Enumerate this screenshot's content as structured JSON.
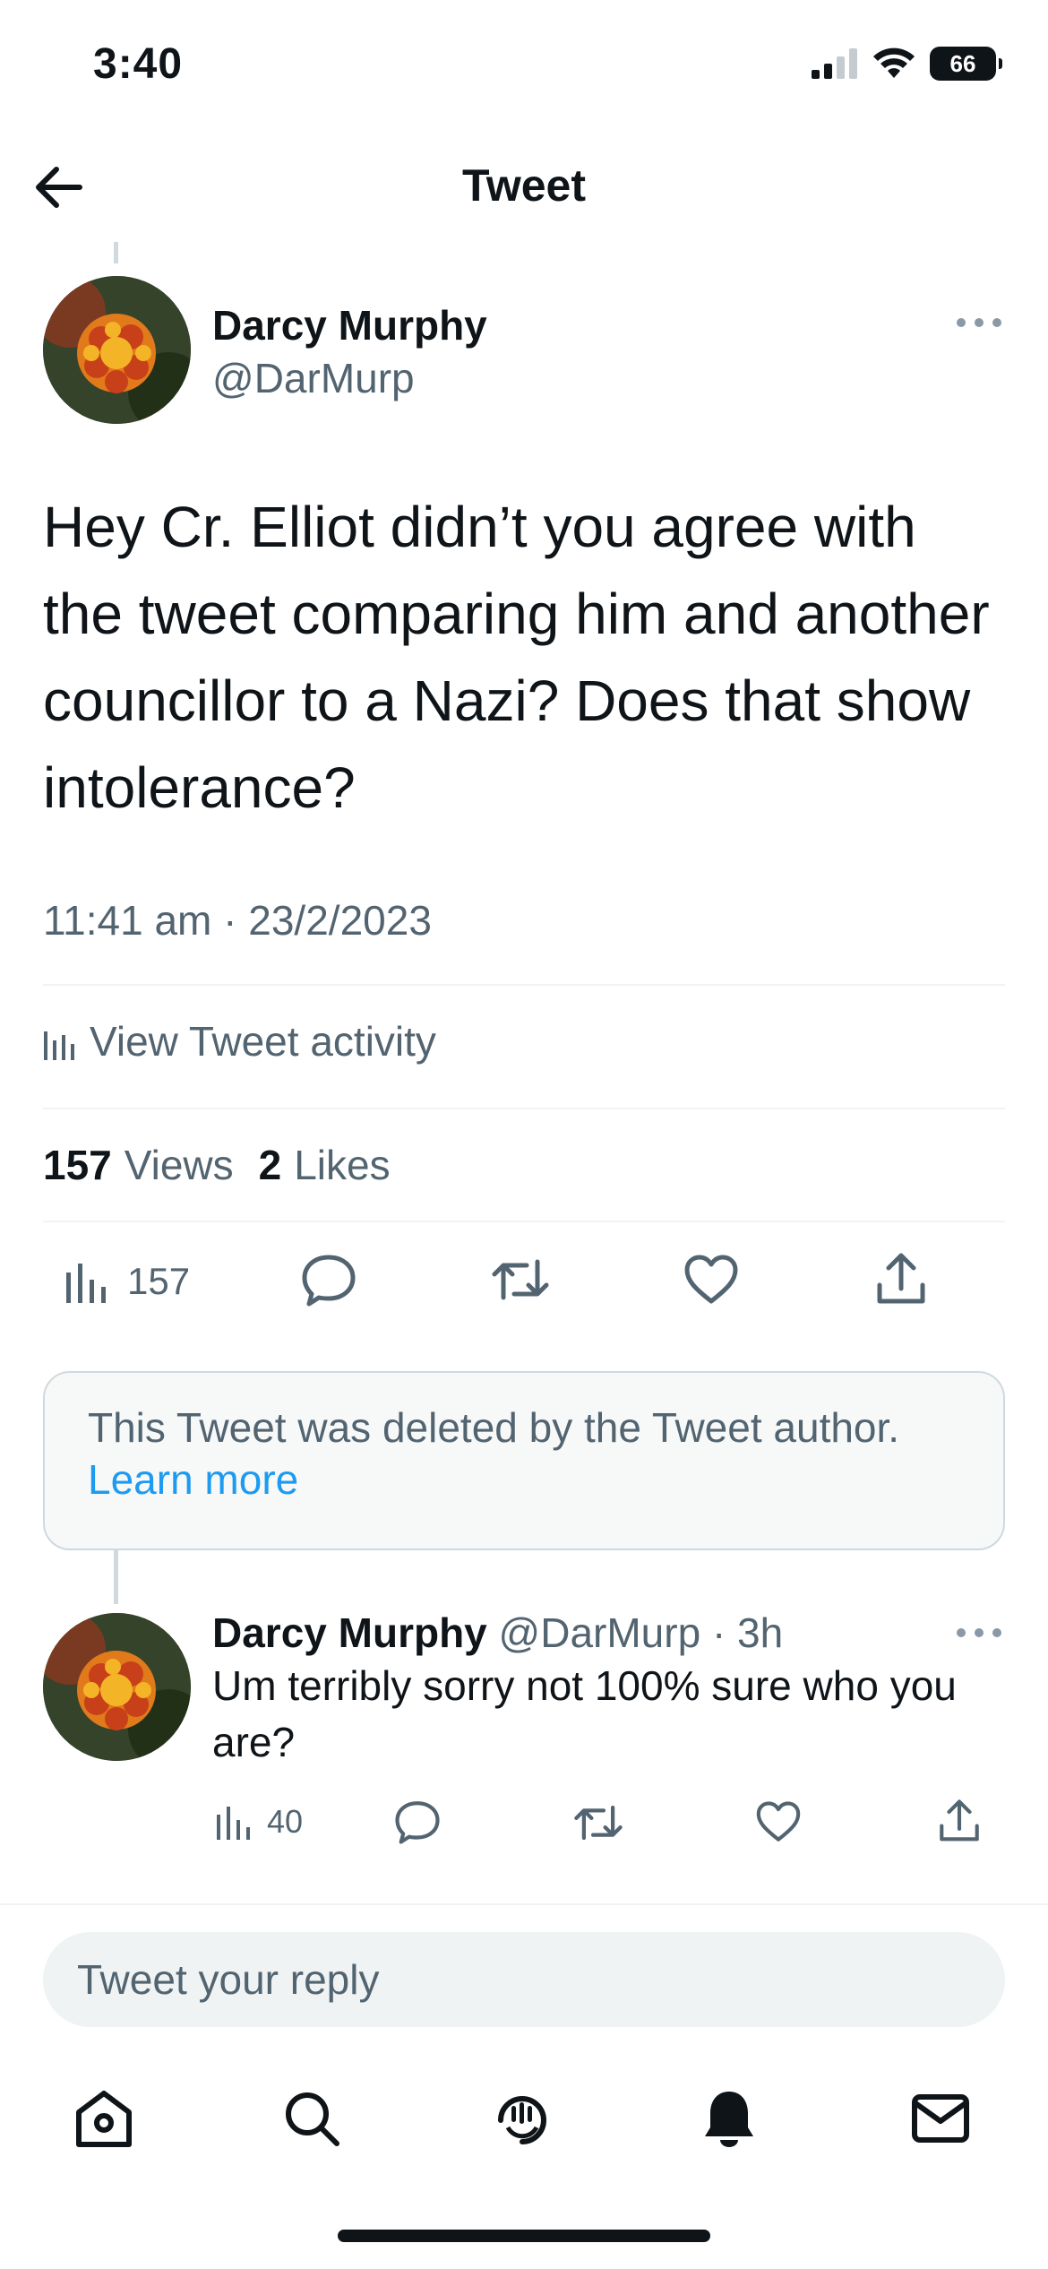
{
  "status_bar": {
    "time": "3:40",
    "battery": "66",
    "icons": [
      "signal-icon",
      "wifi-icon",
      "battery-icon"
    ]
  },
  "header": {
    "title": "Tweet",
    "back_icon": "back-arrow-icon"
  },
  "tweet": {
    "author_name": "Darcy Murphy",
    "author_handle": "@DarMurp",
    "text": "Hey Cr. Elliot didn’t you agree with the tweet comparing him and another councillor to a Nazi? Does that show intolerance?",
    "timestamp": "11:41 am · 23/2/2023",
    "activity_label": "View Tweet activity",
    "views_count": "157",
    "views_label": "Views",
    "likes_count": "2",
    "likes_label": "Likes",
    "action_views": "157",
    "actions": [
      "views-icon",
      "reply-icon",
      "retweet-icon",
      "like-icon",
      "share-icon"
    ]
  },
  "deleted_notice": {
    "text": "This Tweet was deleted by the Tweet author.",
    "link": "Learn more"
  },
  "reply": {
    "author_name": "Darcy Murphy",
    "author_handle": "@DarMurp",
    "time": "· 3h",
    "text": "Um terribly sorry not 100% sure who you are?",
    "views": "40"
  },
  "composer": {
    "placeholder": "Tweet your reply"
  },
  "tab_bar": {
    "tabs": [
      "home-icon",
      "search-icon",
      "spaces-icon",
      "notifications-icon",
      "messages-icon"
    ]
  },
  "colors": {
    "text": "#0f1419",
    "secondary": "#536471",
    "link": "#1d9bf0",
    "divider": "#eff3f4"
  }
}
